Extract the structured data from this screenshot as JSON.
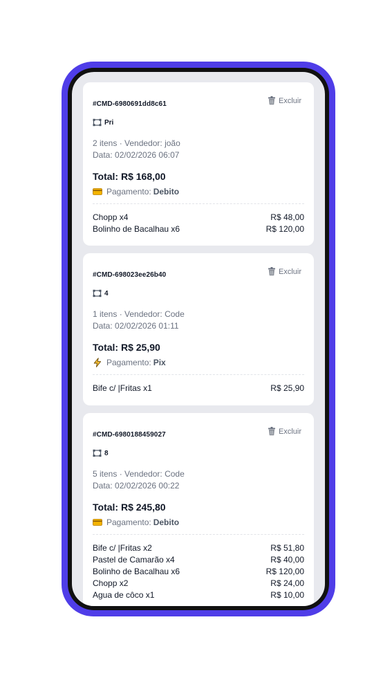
{
  "orders": [
    {
      "id": "#CMD-6980691dd8c61",
      "delete_label": "Excluir",
      "table": "Pri",
      "meta_line": "2 itens · Vendedor: joão",
      "date_line": "Data: 02/02/2026 06:07",
      "total": "Total: R$ 168,00",
      "payment_label": "Pagamento:",
      "payment_method": "Debito",
      "payment_icon": "card-icon",
      "items": [
        {
          "name": "Chopp x4",
          "price": "R$ 48,00"
        },
        {
          "name": "Bolinho de Bacalhau x6",
          "price": "R$ 120,00"
        }
      ]
    },
    {
      "id": "#CMD-698023ee26b40",
      "delete_label": "Excluir",
      "table": "4",
      "meta_line": "1 itens · Vendedor: Code",
      "date_line": "Data: 02/02/2026 01:11",
      "total": "Total: R$ 25,90",
      "payment_label": "Pagamento:",
      "payment_method": "Pix",
      "payment_icon": "lightning-icon",
      "items": [
        {
          "name": "Bife c/ |Fritas x1",
          "price": "R$ 25,90"
        }
      ]
    },
    {
      "id": "#CMD-6980188459027",
      "delete_label": "Excluir",
      "table": "8",
      "meta_line": "5 itens · Vendedor: Code",
      "date_line": "Data: 02/02/2026 00:22",
      "total": "Total: R$ 245,80",
      "payment_label": "Pagamento:",
      "payment_method": "Debito",
      "payment_icon": "card-icon",
      "items": [
        {
          "name": "Bife c/ |Fritas x2",
          "price": "R$ 51,80"
        },
        {
          "name": "Pastel de Camarão x4",
          "price": "R$ 40,00"
        },
        {
          "name": "Bolinho de Bacalhau x6",
          "price": "R$ 120,00"
        },
        {
          "name": "Chopp x2",
          "price": "R$ 24,00"
        },
        {
          "name": "Agua de côco x1",
          "price": "R$ 10,00"
        }
      ]
    }
  ],
  "colors": {
    "frame": "#4f3de8",
    "screen_bg": "#e8e9ee",
    "muted_text": "#6b7280"
  }
}
